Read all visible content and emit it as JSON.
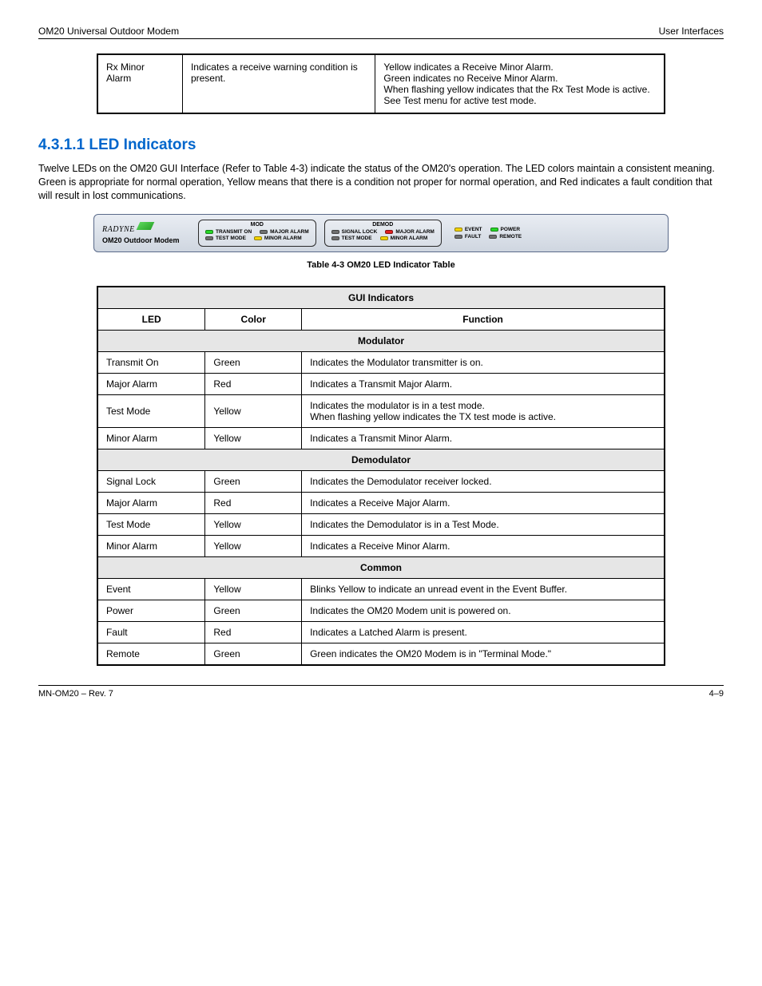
{
  "header": {
    "left": "OM20 Universal Outdoor Modem",
    "right": "User Interfaces"
  },
  "table1": {
    "col1_a": "Rx Minor",
    "col1_b": "Alarm",
    "col2": "Indicates a receive warning condition is present.",
    "col3_l1": "Yellow indicates a Receive Minor Alarm.",
    "col3_l2": "Green indicates no Receive Minor Alarm.",
    "col3_l3": "When flashing yellow indicates that the Rx Test Mode is active. See Test menu for active test mode."
  },
  "section": {
    "num_title": "4.3.1.1 LED Indicators",
    "para": "Twelve LEDs on the OM20 GUI Interface (Refer to Table 4-3) indicate the status of the OM20's operation. The LED colors maintain a consistent meaning. Green is appropriate for normal operation, Yellow means that there is a condition not proper for normal operation, and Red indicates a fault condition that will result in lost communications.",
    "fig_caption": "Table 4-3 OM20 LED Indicator Table"
  },
  "panel": {
    "brand": "RADYNE",
    "product": "OM20 Outdoor Modem",
    "mod": {
      "title": "MOD",
      "row1": [
        {
          "c": "green",
          "t": "TRANSMIT ON"
        },
        {
          "c": "gray",
          "t": "MAJOR ALARM"
        }
      ],
      "row2": [
        {
          "c": "gray",
          "t": "TEST MODE"
        },
        {
          "c": "yellow",
          "t": "MINOR ALARM"
        }
      ]
    },
    "demod": {
      "title": "DEMOD",
      "row1": [
        {
          "c": "gray",
          "t": "SIGNAL LOCK"
        },
        {
          "c": "red",
          "t": "MAJOR ALARM"
        }
      ],
      "row2": [
        {
          "c": "gray",
          "t": "TEST MODE"
        },
        {
          "c": "yellow",
          "t": "MINOR ALARM"
        }
      ]
    },
    "right": {
      "row1": [
        {
          "c": "yellow",
          "t": "EVENT"
        },
        {
          "c": "green",
          "t": "POWER"
        }
      ],
      "row2": [
        {
          "c": "gray",
          "t": "FAULT"
        },
        {
          "c": "gray",
          "t": "REMOTE"
        }
      ]
    }
  },
  "table2": {
    "title": "GUI Indicators",
    "headers": [
      "LED",
      "Color",
      "Function"
    ],
    "group1": {
      "title": "Modulator",
      "rows": [
        {
          "c1": "Transmit On",
          "c2": "Green",
          "c3": "Indicates the Modulator transmitter is on."
        },
        {
          "c1": "Major Alarm",
          "c2": "Red",
          "c3": "Indicates a Transmit Major Alarm."
        },
        {
          "c1": "Test Mode",
          "c2": "Yellow",
          "c3_l1": "Indicates the modulator is in a test mode.",
          "c3_l2": "When flashing yellow indicates the TX test mode is active."
        },
        {
          "c1": "Minor Alarm",
          "c2": "Yellow",
          "c3": "Indicates a Transmit Minor Alarm."
        }
      ]
    },
    "group2": {
      "title": "Demodulator",
      "rows": [
        {
          "c1": "Signal Lock",
          "c2": "Green",
          "c3": "Indicates the Demodulator receiver locked."
        },
        {
          "c1": "Major Alarm",
          "c2": "Red",
          "c3": "Indicates a Receive Major Alarm."
        },
        {
          "c1": "Test Mode",
          "c2": "Yellow",
          "c3": "Indicates the Demodulator is in a Test Mode."
        },
        {
          "c1": "Minor Alarm",
          "c2": "Yellow",
          "c3": "Indicates a Receive Minor Alarm."
        }
      ]
    },
    "group3": {
      "title": "Common",
      "rows": [
        {
          "c1": "Event",
          "c2": "Yellow",
          "c3": "Blinks Yellow to indicate an unread event in the Event Buffer."
        },
        {
          "c1": "Power",
          "c2": "Green",
          "c3": "Indicates the OM20 Modem unit is powered on."
        },
        {
          "c1": "Fault",
          "c2": "Red",
          "c3": "Indicates a Latched Alarm is present."
        },
        {
          "c1": "Remote",
          "c2": "Green",
          "c3": "Green indicates the OM20 Modem is in \"Terminal Mode.\""
        }
      ]
    }
  },
  "footer": {
    "left": "MN-OM20 – Rev. 7",
    "right": "4–9"
  }
}
